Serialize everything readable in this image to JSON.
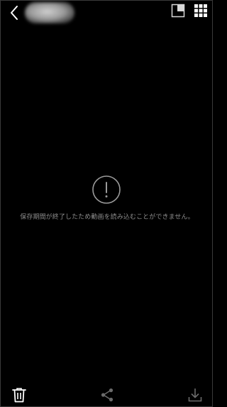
{
  "header": {
    "back_icon": "chevron-left-icon",
    "avatar": "blurred-profile-avatar",
    "pip_icon": "picture-in-picture-icon",
    "grid_icon": "grid-icon"
  },
  "main": {
    "error_icon": "exclamation-circle-icon",
    "error_message": "保存期間が終了したため動画を読み込むことができません。"
  },
  "toolbar": {
    "delete_icon": "trash-icon",
    "share_icon": "share-icon",
    "download_icon": "download-icon"
  },
  "colors": {
    "background": "#000000",
    "icon": "#e6e6e6",
    "muted_icon": "#6b6b6b",
    "text": "#8c8c8c"
  }
}
